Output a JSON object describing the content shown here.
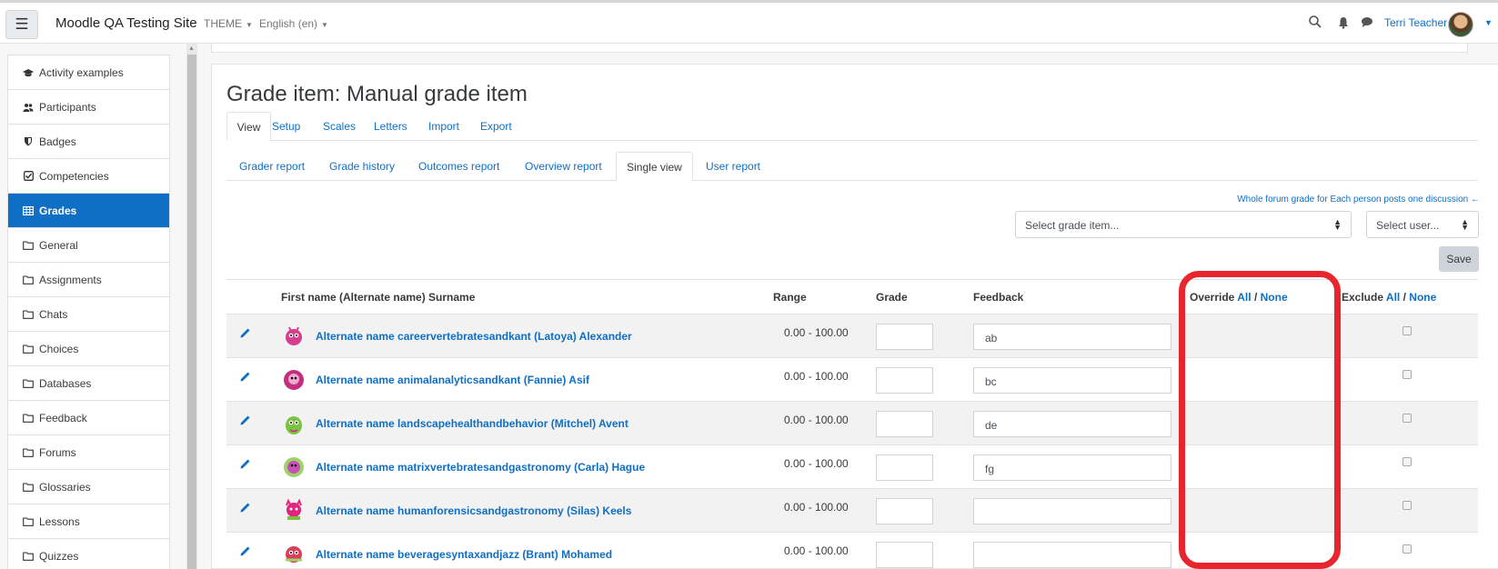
{
  "navbar": {
    "site_name": "Moodle QA Testing Site",
    "theme_menu": "THEME",
    "language_menu": "English (en)",
    "user_name": "Terri Teacher",
    "icons": [
      "hamburger-icon",
      "search-icon",
      "bell-icon",
      "chat-icon"
    ]
  },
  "sidebar": {
    "items": [
      {
        "label": "Activity examples",
        "icon": "graduation-cap-icon"
      },
      {
        "label": "Participants",
        "icon": "users-icon"
      },
      {
        "label": "Badges",
        "icon": "shield-icon"
      },
      {
        "label": "Competencies",
        "icon": "check-square-icon"
      },
      {
        "label": "Grades",
        "icon": "table-icon",
        "active": true
      },
      {
        "label": "General",
        "icon": "folder-icon"
      },
      {
        "label": "Assignments",
        "icon": "folder-icon"
      },
      {
        "label": "Chats",
        "icon": "folder-icon"
      },
      {
        "label": "Choices",
        "icon": "folder-icon"
      },
      {
        "label": "Databases",
        "icon": "folder-icon"
      },
      {
        "label": "Feedback",
        "icon": "folder-icon"
      },
      {
        "label": "Forums",
        "icon": "folder-icon"
      },
      {
        "label": "Glossaries",
        "icon": "folder-icon"
      },
      {
        "label": "Lessons",
        "icon": "folder-icon"
      },
      {
        "label": "Quizzes",
        "icon": "folder-icon"
      }
    ]
  },
  "main": {
    "title": "Grade item: Manual grade item",
    "tabs": [
      "View",
      "Setup",
      "Scales",
      "Letters",
      "Import",
      "Export"
    ],
    "subtabs": [
      "Grader report",
      "Grade history",
      "Outcomes report",
      "Overview report",
      "Single view",
      "User report"
    ],
    "whole_forum_link": "Whole forum grade for Each person posts one discussion ←",
    "select_grade_item": "Select grade item...",
    "select_user": "Select user...",
    "save_label": "Save"
  },
  "table": {
    "headers": {
      "name": "First name (Alternate name) Surname",
      "range": "Range",
      "grade": "Grade",
      "feedback": "Feedback",
      "override": "Override",
      "exclude": "Exclude",
      "all": "All",
      "separator": "/",
      "none": "None"
    },
    "rows": [
      {
        "name": "Alternate name careervertebratesandkant (Latoya) Alexander",
        "range": "0.00 - 100.00",
        "grade": "",
        "feedback": "ab"
      },
      {
        "name": "Alternate name animalanalyticsandkant (Fannie) Asif",
        "range": "0.00 - 100.00",
        "grade": "",
        "feedback": "bc"
      },
      {
        "name": "Alternate name landscapehealthandbehavior (Mitchel) Avent",
        "range": "0.00 - 100.00",
        "grade": "",
        "feedback": "de"
      },
      {
        "name": "Alternate name matrixvertebratesandgastronomy (Carla) Hague",
        "range": "0.00 - 100.00",
        "grade": "",
        "feedback": "fg"
      },
      {
        "name": "Alternate name humanforensicsandgastronomy (Silas) Keels",
        "range": "0.00 - 100.00",
        "grade": "",
        "feedback": ""
      },
      {
        "name": "Alternate name beveragesyntaxandjazz (Brant) Mohamed",
        "range": "0.00 - 100.00",
        "grade": "",
        "feedback": ""
      }
    ]
  },
  "colors": {
    "brand": "#0f6fc5",
    "highlight": "#e8242c",
    "monster_colors": [
      "#d63e8f",
      "#c2307d",
      "#7cc242",
      "#c94fb8",
      "#e0257f",
      "#d93f5a"
    ]
  }
}
